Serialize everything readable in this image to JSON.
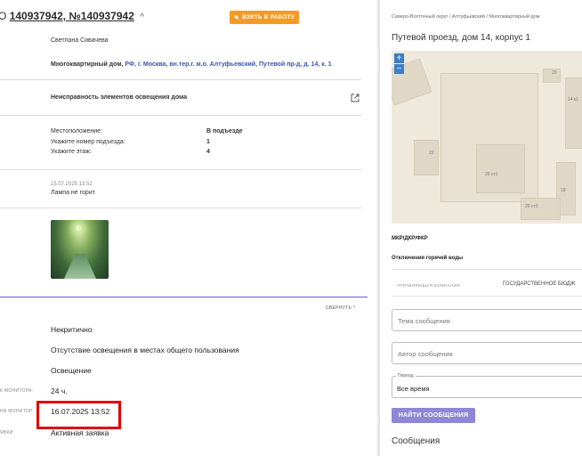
{
  "header": {
    "title_prefix": "О",
    "title_numbers": "140937942, №140937942",
    "title_chevron": "^",
    "take_button": "ВЗЯТЬ В РАБОТУ"
  },
  "applicant": {
    "name": "Светлана Сивачева",
    "object_type": "Многоквартирный дом,",
    "object_address": "РФ, г. Москва, вн.тер.г. м.о. Алтуфьевский, Путевой пр-д, д. 14, к. 1"
  },
  "problem": {
    "title": "Неисправность элементов освещения дома"
  },
  "location": {
    "rows": [
      {
        "label": "Местоположение:",
        "value": "В подъезде"
      },
      {
        "label": "Укажите номер подъезда:",
        "value": "1"
      },
      {
        "label": "Укажите этаж:",
        "value": "4"
      }
    ]
  },
  "comment": {
    "date": "15.07.2025 13:52",
    "text": "Лампа не горит"
  },
  "details": {
    "collapse_label": "СВЕРНУТЬ ^",
    "rows": [
      {
        "label": "",
        "value": "Некритично"
      },
      {
        "label": "",
        "value": "Отсутствие освещения в местах общего пользования"
      },
      {
        "label": "",
        "value": "Освещение"
      },
      {
        "label": "К МОНИТОРА:",
        "value": "24 ч."
      },
      {
        "label": "НА МОНИТОР:",
        "value": "16.07.2025 13:52"
      },
      {
        "label": "ЯВКИ:",
        "value": "Активная заявка"
      }
    ]
  },
  "right": {
    "breadcrumb": "Северо-Восточный округ / Алтуфьевский / Многоквартирный дом",
    "address": "Путевой проезд, дом 14, корпус 1",
    "map": {
      "zoom_in": "+",
      "zoom_out": "−",
      "labels": [
        "20",
        "14 к1",
        "22",
        "20 ст1",
        "18",
        "20 ст3"
      ]
    },
    "mkr": "МКР/ДКР/ФКР",
    "hot_water": "Отключения горячей воды",
    "uk_label": "УПРАВЛЯЮЩАЯ КОМПАНИЯ",
    "uk_value": "ГОСУДАРСТВЕННОЕ БЮДЖ",
    "message_topic_placeholder": "Тема сообщения",
    "message_author_placeholder": "Автор сообщения",
    "period_legend": "Период",
    "period_value": "Все время",
    "find_button": "НАЙТИ СООБЩЕНИЯ",
    "messages_title": "Сообщения"
  }
}
